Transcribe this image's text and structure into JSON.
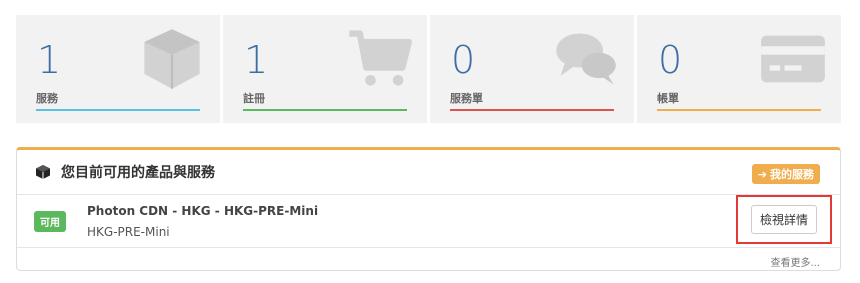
{
  "stats": [
    {
      "count": "1",
      "label": "服務",
      "color": "#5bc0de",
      "icon": "cube-icon"
    },
    {
      "count": "1",
      "label": "註冊",
      "color": "#5cb85c",
      "icon": "cart-icon"
    },
    {
      "count": "0",
      "label": "服務單",
      "color": "#d9534f",
      "icon": "chat-icon"
    },
    {
      "count": "0",
      "label": "帳單",
      "color": "#f0ad4e",
      "icon": "credit-card-icon"
    }
  ],
  "panel": {
    "title": "您目前可用的產品與服務",
    "header_button": "我的服務",
    "accent": "#f0ad4e",
    "rows": [
      {
        "status": "可用",
        "name": "Photon CDN - HKG - HKG-PRE-Mini",
        "sub": "HKG-PRE-Mini",
        "action": "檢視詳情"
      }
    ],
    "more_link": "查看更多..."
  }
}
